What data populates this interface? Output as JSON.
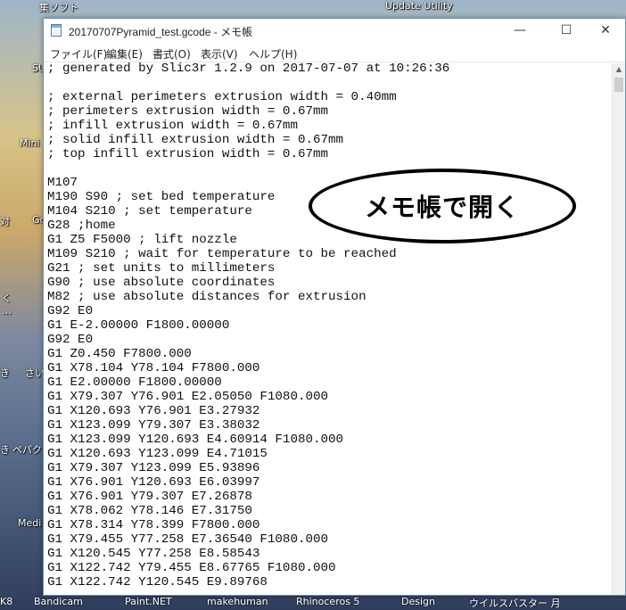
{
  "desktop": {
    "top_labels": [
      "集ソフト",
      "Update Utility"
    ],
    "left_labels": [
      "SU",
      "Mini",
      "対",
      "Go",
      "く",
      "…",
      "き",
      "さい",
      "き",
      "ペパク",
      "Medi"
    ],
    "taskbar_labels": [
      "K8",
      "Bandicam",
      "Paint.NET",
      "makehuman",
      "Rhinoceros 5",
      "Design",
      "ウイルスバスター 月"
    ]
  },
  "window": {
    "title": "20170707Pyramid_test.gcode - メモ帳",
    "minimize_glyph": "—",
    "maximize_glyph": "☐",
    "close_glyph": "✕",
    "menu": [
      "ファイル(F)",
      "編集(E)",
      "書式(O)",
      "表示(V)",
      "ヘルプ(H)"
    ]
  },
  "editor": {
    "lines": [
      "; generated by Slic3r 1.2.9 on 2017-07-07 at 10:26:36",
      "",
      "; external perimeters extrusion width = 0.40mm",
      "; perimeters extrusion width = 0.67mm",
      "; infill extrusion width = 0.67mm",
      "; solid infill extrusion width = 0.67mm",
      "; top infill extrusion width = 0.67mm",
      "",
      "M107",
      "M190 S90 ; set bed temperature",
      "M104 S210 ; set temperature",
      "G28 ;home",
      "G1 Z5 F5000 ; lift nozzle",
      "M109 S210 ; wait for temperature to be reached",
      "G21 ; set units to millimeters",
      "G90 ; use absolute coordinates",
      "M82 ; use absolute distances for extrusion",
      "G92 E0",
      "G1 E-2.00000 F1800.00000",
      "G92 E0",
      "G1 Z0.450 F7800.000",
      "G1 X78.104 Y78.104 F7800.000",
      "G1 E2.00000 F1800.00000",
      "G1 X79.307 Y76.901 E2.05050 F1080.000",
      "G1 X120.693 Y76.901 E3.27932",
      "G1 X123.099 Y79.307 E3.38032",
      "G1 X123.099 Y120.693 E4.60914 F1080.000",
      "G1 X120.693 Y123.099 E4.71015",
      "G1 X79.307 Y123.099 E5.93896",
      "G1 X76.901 Y120.693 E6.03997",
      "G1 X76.901 Y79.307 E7.26878",
      "G1 X78.062 Y78.146 E7.31750",
      "G1 X78.314 Y78.399 F7800.000",
      "G1 X79.455 Y77.258 E7.36540 F1080.000",
      "G1 X120.545 Y77.258 E8.58543",
      "G1 X122.742 Y79.455 E8.67765 F1080.000",
      "G1 X122.742 Y120.545 E9.89768"
    ]
  },
  "callout": {
    "text": "メモ帳で開く"
  }
}
